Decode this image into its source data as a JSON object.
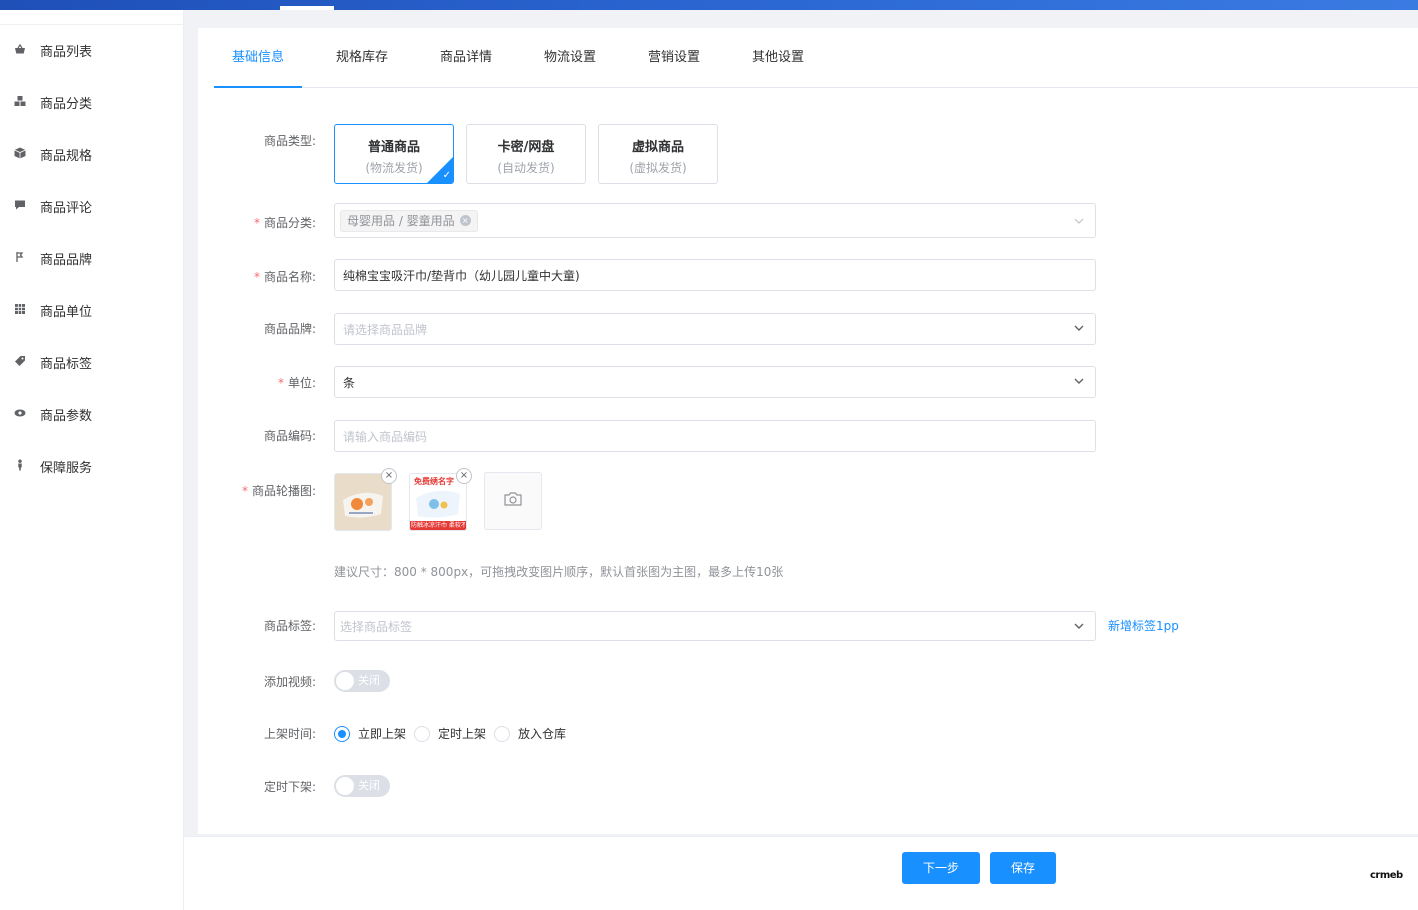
{
  "sidebar": {
    "items": [
      {
        "label": "商品列表",
        "icon": "basket-icon"
      },
      {
        "label": "商品分类",
        "icon": "cubes-icon"
      },
      {
        "label": "商品规格",
        "icon": "cube-icon"
      },
      {
        "label": "商品评论",
        "icon": "comment-icon"
      },
      {
        "label": "商品品牌",
        "icon": "tag-brand-icon"
      },
      {
        "label": "商品单位",
        "icon": "grid-icon"
      },
      {
        "label": "商品标签",
        "icon": "tag-icon"
      },
      {
        "label": "商品参数",
        "icon": "eye-icon"
      },
      {
        "label": "保障服务",
        "icon": "shield-icon"
      }
    ]
  },
  "tabs": [
    "基础信息",
    "规格库存",
    "商品详情",
    "物流设置",
    "营销设置",
    "其他设置"
  ],
  "form": {
    "type": {
      "label": "商品类型:",
      "options": [
        {
          "title": "普通商品",
          "sub": "(物流发货)"
        },
        {
          "title": "卡密/网盘",
          "sub": "(自动发货)"
        },
        {
          "title": "虚拟商品",
          "sub": "(虚拟发货)"
        }
      ]
    },
    "category": {
      "label": "商品分类:",
      "tag": "母婴用品 / 婴童用品"
    },
    "name": {
      "label": "商品名称:",
      "value": "纯棉宝宝吸汗巾/垫背巾（幼儿园儿童中大童)"
    },
    "brand": {
      "label": "商品品牌:",
      "placeholder": "请选择商品品牌"
    },
    "unit": {
      "label": "单位:",
      "value": "条"
    },
    "code": {
      "label": "商品编码:",
      "placeholder": "请输入商品编码"
    },
    "images": {
      "label": "商品轮播图:",
      "thumb2_text": "免费绣名字",
      "thumb2_band": "防触冰凉汗巾 柔软不起球",
      "hint": "建议尺寸：800 * 800px，可拖拽改变图片顺序，默认首张图为主图，最多上传10张"
    },
    "tags": {
      "label": "商品标签:",
      "placeholder": "选择商品标签",
      "link": "新增标签1pp"
    },
    "video": {
      "label": "添加视频:",
      "state": "关闭"
    },
    "shelf": {
      "label": "上架时间:",
      "options": [
        "立即上架",
        "定时上架",
        "放入仓库"
      ]
    },
    "offshelf": {
      "label": "定时下架:",
      "state": "关闭"
    }
  },
  "footer": {
    "next": "下一步",
    "save": "保存"
  },
  "brand_logo": "crmeb",
  "colors": {
    "primary": "#1890ff",
    "required": "#f56c6c"
  }
}
